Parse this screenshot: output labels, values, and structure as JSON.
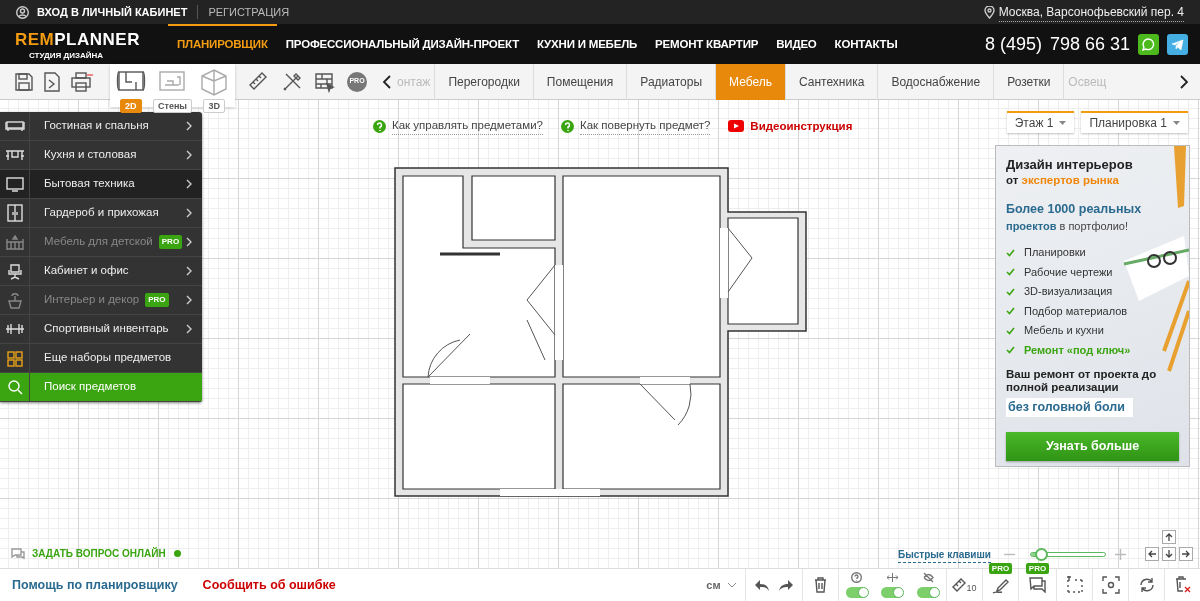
{
  "top_bar": {
    "login": "ВХОД В ЛИЧНЫЙ КАБИНЕТ",
    "register": "РЕГИСТРАЦИЯ",
    "address": "Москва, Варсонофьевский пер. 4"
  },
  "header": {
    "logo_accent": "REM",
    "logo_rest": "PLANNER",
    "logo_tagline": "СТУДИЯ ДИЗАЙНА",
    "phone_code": "8 (495)",
    "phone_number": "798 66 31",
    "nav": [
      {
        "label": "ПЛАНИРОВЩИК",
        "selected": true
      },
      {
        "label": "ПРОФЕССИОНАЛЬНЫЙ ДИЗАЙН-ПРОЕКТ",
        "selected": false
      },
      {
        "label": "КУХНИ И МЕБЕЛЬ",
        "selected": false
      },
      {
        "label": "РЕМОНТ КВАРТИР",
        "selected": false
      },
      {
        "label": "ВИДЕО",
        "selected": false
      },
      {
        "label": "КОНТАКТЫ",
        "selected": false
      }
    ]
  },
  "toolbar": {
    "pro_label": "PRO",
    "modes": [
      {
        "label": "2D",
        "selected": true
      },
      {
        "label": "Стены",
        "selected": false
      },
      {
        "label": "3D",
        "selected": false
      }
    ],
    "tabs": [
      {
        "label": "онтаж",
        "selected": false
      },
      {
        "label": "Перегородки",
        "selected": false
      },
      {
        "label": "Помещения",
        "selected": false
      },
      {
        "label": "Радиаторы",
        "selected": false
      },
      {
        "label": "Мебель",
        "selected": true
      },
      {
        "label": "Сантехника",
        "selected": false
      },
      {
        "label": "Водоснабжение",
        "selected": false
      },
      {
        "label": "Розетки",
        "selected": false
      },
      {
        "label": "Освещ",
        "selected": false
      }
    ]
  },
  "side_menu": [
    {
      "label": "Гостиная и спальня",
      "kind": "category",
      "selected": false,
      "disabled": false
    },
    {
      "label": "Кухня и столовая",
      "kind": "category",
      "selected": false,
      "disabled": false
    },
    {
      "label": "Бытовая техника",
      "kind": "category",
      "selected": true,
      "disabled": false
    },
    {
      "label": "Гардероб и прихожая",
      "kind": "category",
      "selected": false,
      "disabled": false
    },
    {
      "label": "Мебель для детской",
      "kind": "category",
      "selected": false,
      "disabled": true,
      "badge": "PRO"
    },
    {
      "label": "Кабинет и офис",
      "kind": "category",
      "selected": false,
      "disabled": false
    },
    {
      "label": "Интерьер и декор",
      "kind": "category",
      "selected": false,
      "disabled": true,
      "badge": "PRO"
    },
    {
      "label": "Спортивный инвентарь",
      "kind": "category",
      "selected": false,
      "disabled": false
    },
    {
      "label": "Еще наборы предметов",
      "kind": "more",
      "selected": false,
      "disabled": false
    },
    {
      "label": "Поиск предметов",
      "kind": "search",
      "selected": false,
      "disabled": false
    }
  ],
  "help_links": [
    {
      "label": "Как управлять предметами?",
      "kind": "help"
    },
    {
      "label": "Как повернуть предмет?",
      "kind": "help"
    },
    {
      "label": "Видеоинструкция",
      "kind": "video"
    }
  ],
  "floor_selects": [
    {
      "label": "Этаж 1"
    },
    {
      "label": "Планировка 1"
    }
  ],
  "banner": {
    "title": "Дизайн интерьеров",
    "subtitle_prefix": "от",
    "subtitle_accent": "экспертов рынка",
    "headline": "Более 1000 реальных",
    "headline_accent": "проектов",
    "headline_rest": "в портфолио!",
    "features": [
      {
        "label": "Планировки",
        "highlight": false
      },
      {
        "label": "Рабочие чертежи",
        "highlight": false
      },
      {
        "label": "3D-визуализация",
        "highlight": false
      },
      {
        "label": "Подбор материалов",
        "highlight": false
      },
      {
        "label": "Мебель и кухни",
        "highlight": false
      },
      {
        "label": "Ремонт «под ключ»",
        "highlight": true
      }
    ],
    "slogan": "Ваш ремонт от проекта до полной реализации",
    "slogan_accent": "без головной боли",
    "button": "Узнать больше"
  },
  "chat": {
    "label": "ЗАДАТЬ ВОПРОС ОНЛАЙН",
    "online": true
  },
  "shortcuts": "Быстрые клавиши",
  "zoom": {
    "level": 0.13
  },
  "footer": {
    "help": "Помощь по планировщику",
    "report": "Сообщить об ошибке",
    "unit": "см",
    "ruler_label": "10",
    "pro_badges": [
      "PRO",
      "PRO"
    ],
    "toggles": [
      {
        "on": true
      },
      {
        "on": true
      },
      {
        "on": true
      }
    ]
  }
}
